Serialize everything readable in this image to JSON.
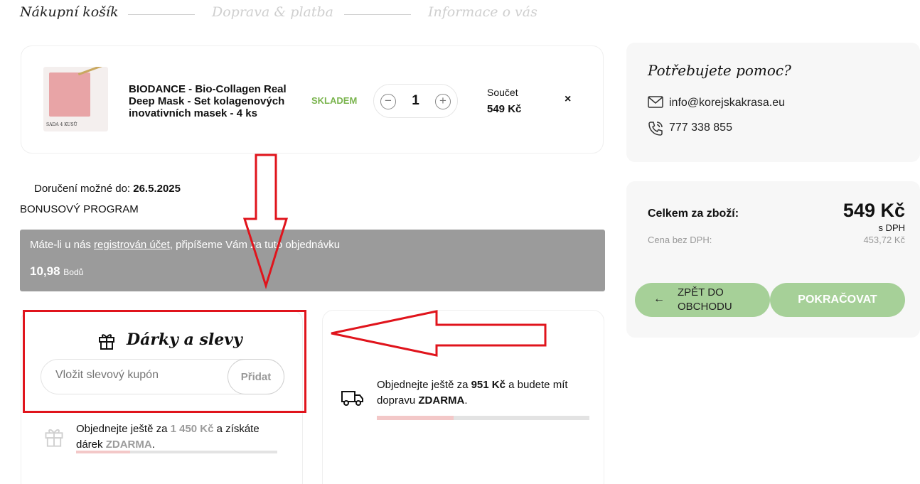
{
  "steps": [
    "Nákupní košík",
    "Doprava & platba",
    "Informace o vás"
  ],
  "item": {
    "name": "BIODANCE - Bio-Collagen Real Deep Mask - Set kolagenových inovativních masek - 4 ks",
    "thumb_caption": "SADA 4 KUSŮ",
    "stock": "SKLADEM",
    "quantity": "1",
    "minus": "−",
    "plus": "+",
    "sum_label": "Součet",
    "sum_value": "549 Kč",
    "remove": "×"
  },
  "delivery": {
    "label": "Doručení možné do:",
    "date": "26.5.2025"
  },
  "bonus": {
    "title": "BONUSOVÝ PROGRAM",
    "text_before": "Máte-li u nás",
    "link": "registrován účet",
    "text_after": ", připíšeme Vám za tuto objednávku",
    "points": "10,98",
    "points_unit": "Bodů"
  },
  "gifts": {
    "title": "Dárky a slevy",
    "coupon_placeholder": "Vložit slevový kupón",
    "add_label": "Přidat",
    "free_before": "Objednejte ještě za",
    "free_amount": "1 450 Kč",
    "free_mid": "a získáte dárek",
    "free_word": "ZDARMA",
    "free_end": ".",
    "progress_pct": 27
  },
  "shipping": {
    "text_before": "Objednejte ještě za",
    "amount": "951 Kč",
    "text_mid": "a budete mít dopravu",
    "free_word": "ZDARMA",
    "text_end": ".",
    "progress_pct": 36
  },
  "help": {
    "title": "Potřebujete pomoc?",
    "email": "info@korejskakrasa.eu",
    "phone": "777 338 855"
  },
  "summary": {
    "total_label": "Celkem za zboží:",
    "total_value": "549 Kč",
    "vat_note": "s DPH",
    "net_label": "Cena bez DPH:",
    "net_value": "453,72 Kč",
    "back_label": "ZPĚT DO OBCHODU",
    "continue_label": "POKRAČOVAT"
  },
  "colors": {
    "stock_green": "#7ab44e",
    "button_green": "#a6d098",
    "bonus_gray": "#9b9b9b",
    "progress_pink": "#f3c8c8",
    "annotation_red": "#e0141c"
  }
}
